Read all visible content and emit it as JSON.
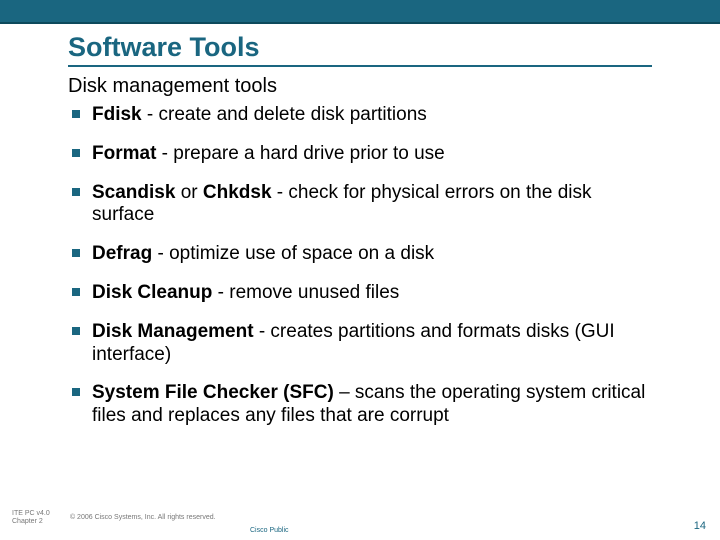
{
  "title": "Software Tools",
  "subtitle": "Disk management tools",
  "bullets": [
    {
      "bold": "Fdisk",
      "rest": " - create and delete disk partitions"
    },
    {
      "bold": "Format",
      "rest": " - prepare a hard drive prior to use"
    },
    {
      "bold": "Scandisk",
      "mid": " or ",
      "bold2": "Chkdsk",
      "rest": " - check for physical errors on the disk surface"
    },
    {
      "bold": "Defrag",
      "rest": " - optimize use of space on a disk"
    },
    {
      "bold": "Disk Cleanup",
      "rest": " - remove unused files"
    },
    {
      "bold": "Disk Management",
      "rest": " - creates partitions and formats disks (GUI interface)"
    },
    {
      "bold": "System File Checker (SFC)",
      "rest": " –  scans the operating system critical files and replaces any files that are corrupt"
    }
  ],
  "footer": {
    "left1": "ITE PC v4.0",
    "left2": "Chapter 2",
    "copyright": "© 2006 Cisco Systems, Inc. All rights reserved.",
    "public": "Cisco Public",
    "page": "14"
  }
}
